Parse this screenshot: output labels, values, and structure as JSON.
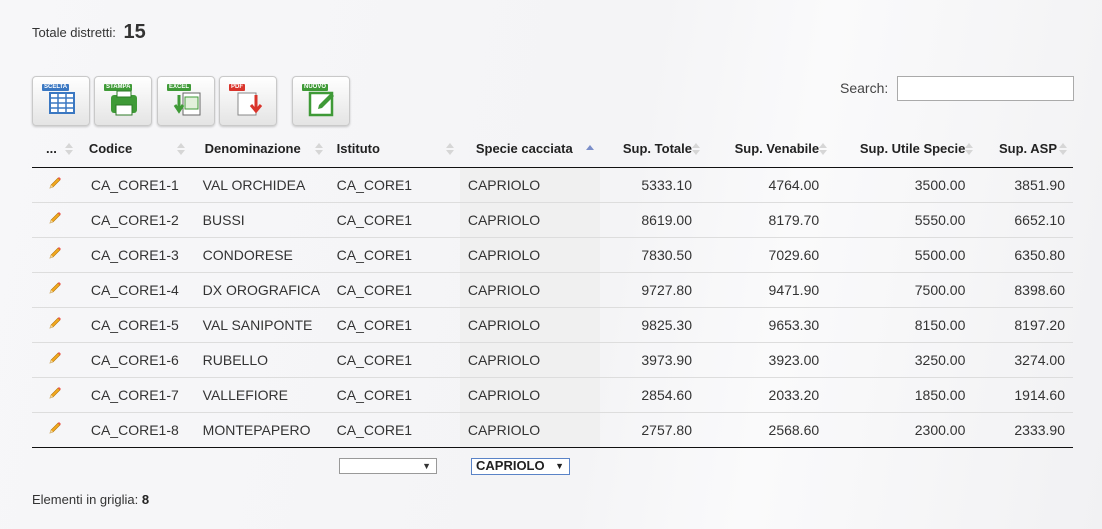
{
  "summary": {
    "label": "Totale distretti:",
    "value": "15"
  },
  "toolbar": {
    "buttons": [
      {
        "tag": "SCELTA",
        "tag_color": "#3b78c2"
      },
      {
        "tag": "STAMPA",
        "tag_color": "#3f9a37",
        "sub": "PRINT"
      },
      {
        "tag": "EXCEL",
        "tag_color": "#3f9a37",
        "sub": "Excel"
      },
      {
        "tag": "PDF",
        "tag_color": "#d9342b"
      },
      {
        "tag": "NUOVO",
        "tag_color": "#3f9a37"
      }
    ]
  },
  "search": {
    "label": "Search:",
    "value": ""
  },
  "table": {
    "columns": [
      "...",
      "Codice",
      "Denominazione",
      "Istituto",
      "Specie cacciata",
      "Sup. Totale",
      "Sup. Venabile",
      "Sup. Utile Specie",
      "Sup. ASP"
    ],
    "rows": [
      [
        "CA_CORE1-1",
        "VAL ORCHIDEA",
        "CA_CORE1",
        "CAPRIOLO",
        "5333.10",
        "4764.00",
        "3500.00",
        "3851.90"
      ],
      [
        "CA_CORE1-2",
        "BUSSI",
        "CA_CORE1",
        "CAPRIOLO",
        "8619.00",
        "8179.70",
        "5550.00",
        "6652.10"
      ],
      [
        "CA_CORE1-3",
        "CONDORESE",
        "CA_CORE1",
        "CAPRIOLO",
        "7830.50",
        "7029.60",
        "5500.00",
        "6350.80"
      ],
      [
        "CA_CORE1-4",
        "DX OROGRAFICA",
        "CA_CORE1",
        "CAPRIOLO",
        "9727.80",
        "9471.90",
        "7500.00",
        "8398.60"
      ],
      [
        "CA_CORE1-5",
        "VAL SANIPONTE",
        "CA_CORE1",
        "CAPRIOLO",
        "9825.30",
        "9653.30",
        "8150.00",
        "8197.20"
      ],
      [
        "CA_CORE1-6",
        "RUBELLO",
        "CA_CORE1",
        "CAPRIOLO",
        "3973.90",
        "3923.00",
        "3250.00",
        "3274.00"
      ],
      [
        "CA_CORE1-7",
        "VALLEFIORE",
        "CA_CORE1",
        "CAPRIOLO",
        "2854.60",
        "2033.20",
        "1850.00",
        "1914.60"
      ],
      [
        "CA_CORE1-8",
        "MONTEPAPERO",
        "CA_CORE1",
        "CAPRIOLO",
        "2757.80",
        "2568.60",
        "2300.00",
        "2333.90"
      ]
    ]
  },
  "filters": {
    "istituto": "",
    "specie": "CAPRIOLO"
  },
  "footer": {
    "label": "Elementi in griglia:",
    "value": "8"
  }
}
